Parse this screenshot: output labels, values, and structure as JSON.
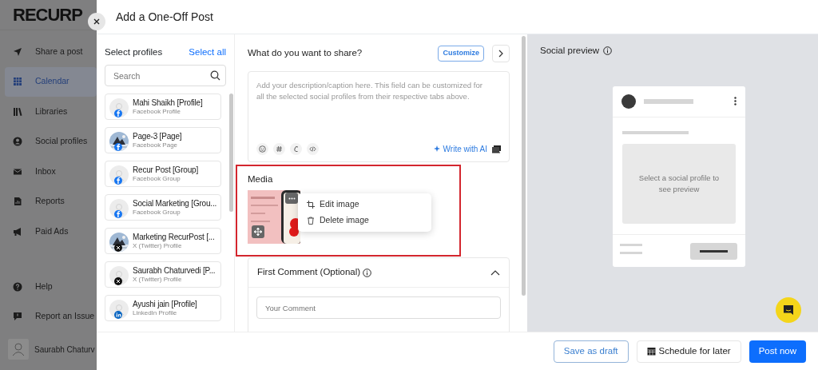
{
  "app": {
    "logo": "RECURP",
    "nav": [
      {
        "label": "Share a post",
        "selected": false
      },
      {
        "label": "Calendar",
        "selected": true
      },
      {
        "label": "Libraries",
        "selected": false
      },
      {
        "label": "Social profiles",
        "selected": false
      },
      {
        "label": "Inbox",
        "selected": false
      },
      {
        "label": "Reports",
        "selected": false
      },
      {
        "label": "Paid Ads",
        "selected": false
      }
    ],
    "bottom_nav": [
      {
        "label": "Help",
        "selected": false
      },
      {
        "label": "Report an Issue",
        "selected": false
      }
    ],
    "user": {
      "name": "Saurabh Chaturv"
    }
  },
  "modal": {
    "title": "Add a One-Off Post",
    "profiles": {
      "heading": "Select profiles",
      "select_all": "Select all",
      "search": {
        "placeholder": "Search"
      },
      "items": [
        {
          "name": "Mahi Shaikh [Profile]",
          "network": "Facebook Profile",
          "kind": "facebook"
        },
        {
          "name": "Page-3 [Page]",
          "network": "Facebook Page",
          "kind": "facebook"
        },
        {
          "name": "Recur Post [Group]",
          "network": "Facebook Group",
          "kind": "facebook"
        },
        {
          "name": "Social Marketing [Grou...",
          "network": "Facebook Group",
          "kind": "facebook"
        },
        {
          "name": "Marketing RecurPost [...",
          "network": "X (Twitter) Profile",
          "kind": "x"
        },
        {
          "name": "Saurabh Chaturvedi [P...",
          "network": "X (Twitter) Profile",
          "kind": "x"
        },
        {
          "name": "Ayushi jain [Profile]",
          "network": "LinkedIn Profile",
          "kind": "linkedin"
        }
      ]
    },
    "composer": {
      "heading": "What do you want to share?",
      "customize": "Customize",
      "placeholder": "Add your description/caption here. This field can be customized for all the selected social profiles from their respective tabs above.",
      "write_with_ai": "Write with AI"
    },
    "media": {
      "heading": "Media",
      "menu": [
        "Edit image",
        "Delete image"
      ]
    },
    "first_comment": {
      "heading": "First Comment (Optional)",
      "expanded": true,
      "placeholder": "Your Comment"
    },
    "preview": {
      "heading": "Social preview",
      "message": "Select a social profile to see preview"
    },
    "footer": {
      "buttons": [
        {
          "label": "Save as draft",
          "kind": "outline"
        },
        {
          "label": "Schedule for later",
          "kind": "calendar"
        },
        {
          "label": "Post now",
          "kind": "primary"
        }
      ]
    }
  }
}
